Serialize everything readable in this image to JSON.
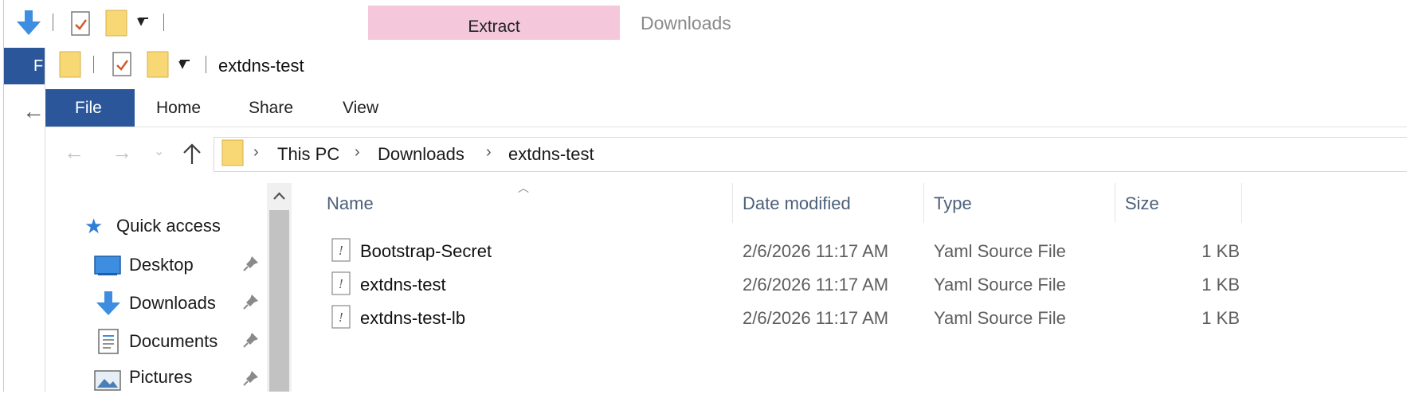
{
  "back_window": {
    "context_tab_label": "Extract",
    "title": "Downloads",
    "file_tab_partial": "F"
  },
  "window": {
    "title": "extdns-test"
  },
  "ribbon": {
    "tabs": [
      "File",
      "Home",
      "Share",
      "View"
    ]
  },
  "address": {
    "breadcrumbs": [
      "This PC",
      "Downloads",
      "extdns-test"
    ]
  },
  "nav_pane": {
    "quick_access_label": "Quick access",
    "items": [
      {
        "label": "Desktop",
        "icon": "desktop-icon",
        "pinned": true
      },
      {
        "label": "Downloads",
        "icon": "download-arrow-icon",
        "pinned": true
      },
      {
        "label": "Documents",
        "icon": "documents-icon",
        "pinned": true
      },
      {
        "label": "Pictures",
        "icon": "pictures-icon",
        "pinned": true
      }
    ]
  },
  "file_list": {
    "columns": [
      "Name",
      "Date modified",
      "Type",
      "Size"
    ],
    "rows": [
      {
        "name": "Bootstrap-Secret",
        "date": "2/6/2026 11:17 AM",
        "type": "Yaml Source File",
        "size": "1 KB"
      },
      {
        "name": "extdns-test",
        "date": "2/6/2026 11:17 AM",
        "type": "Yaml Source File",
        "size": "1 KB"
      },
      {
        "name": "extdns-test-lb",
        "date": "2/6/2026 11:17 AM",
        "type": "Yaml Source File",
        "size": "1 KB"
      }
    ]
  },
  "colors": {
    "file_tab": "#2b579a",
    "context_tab": "#f4c7db",
    "folder": "#f8d775",
    "accent_blue": "#3d8ee0"
  }
}
